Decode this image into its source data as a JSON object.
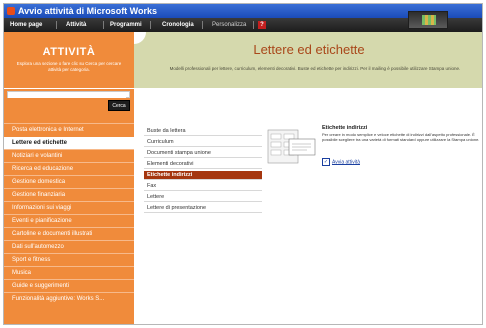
{
  "window": {
    "title": "Avvio attività di Microsoft Works"
  },
  "menu": {
    "items": [
      {
        "label": "Home page"
      },
      {
        "label": "Attività"
      },
      {
        "label": "Programmi"
      },
      {
        "label": "Cronologia"
      },
      {
        "label": "Personalizza"
      },
      {
        "label": "?"
      }
    ]
  },
  "sidebar": {
    "brand": "ATTIVITÀ",
    "tagline": "Esplora una sezione o fare clic su Cerca per cercare attività per categoria.",
    "search": {
      "value": "",
      "placeholder": ""
    },
    "search_button": "Cerca",
    "categories": [
      {
        "label": "Posta elettronica e Internet",
        "selected": false
      },
      {
        "label": "Lettere ed etichette",
        "selected": true
      },
      {
        "label": "Notiziari e volantini",
        "selected": false
      },
      {
        "label": "Ricerca ed educazione",
        "selected": false
      },
      {
        "label": "Gestione domestica",
        "selected": false
      },
      {
        "label": "Gestione finanziaria",
        "selected": false
      },
      {
        "label": "Informazioni sui viaggi",
        "selected": false
      },
      {
        "label": "Eventi e pianificazione",
        "selected": false
      },
      {
        "label": "Cartoline e documenti illustrati",
        "selected": false
      },
      {
        "label": "Dati sull'automezzo",
        "selected": false
      },
      {
        "label": "Sport e fitness",
        "selected": false
      },
      {
        "label": "Musica",
        "selected": false
      },
      {
        "label": "Guide e suggerimenti",
        "selected": false
      },
      {
        "label": "Funzionalità aggiuntive: Works S...",
        "selected": false
      }
    ]
  },
  "header": {
    "title": "Lettere ed etichette",
    "subtitle": "Modelli professionali per lettere, curriculum, elementi decorativi. Buste ed etichette per indirizzi. Per il mailing è possibile utilizzare Stampa unione."
  },
  "tasks": [
    {
      "label": "Buste da lettera",
      "selected": false
    },
    {
      "label": "Curriculum",
      "selected": false
    },
    {
      "label": "Documenti stampa unione",
      "selected": false
    },
    {
      "label": "Elementi decorativi",
      "selected": false
    },
    {
      "label": "Etichette indirizzi",
      "selected": true
    },
    {
      "label": "Fax",
      "selected": false
    },
    {
      "label": "Lettere",
      "selected": false
    },
    {
      "label": "Lettere di presentazione",
      "selected": false
    }
  ],
  "detail": {
    "title": "Etichette indirizzi",
    "description": "Per creare in modo semplice e veloce etichette di indirizzi dall'aspetto professionale. È possibile scegliere tra una varietà di formati standard oppure utilizzare la Stampa unione.",
    "start_link": "Avvia attività"
  },
  "colors": {
    "sidebar": "#f08b3b",
    "header": "#d5d9ad",
    "selected_task": "#a5360f",
    "title_text": "#a9471a"
  }
}
